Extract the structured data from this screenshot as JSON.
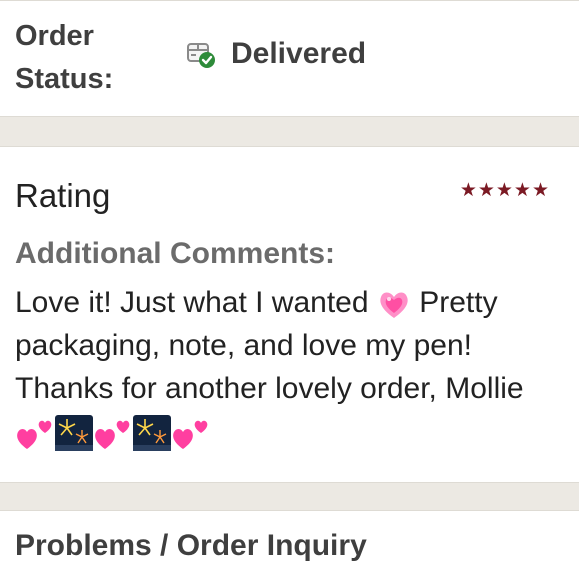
{
  "order_status": {
    "label": "Order Status:",
    "value": "Delivered",
    "icon": "package-delivered-icon",
    "check_color": "#2e8b3a"
  },
  "rating": {
    "title": "Rating",
    "stars": "★★★★★",
    "score": 5,
    "max": 5,
    "star_color": "#7b1a24"
  },
  "comments": {
    "label": "Additional Comments:",
    "text_part1": "Love it! Just what I wanted",
    "text_part2": " Pretty packaging, note, and love my pen! Thanks for another lovely order, Mollie ",
    "emoji_icons": [
      "sparkling-heart-icon",
      "two-hearts-icon",
      "fireworks-icon",
      "two-hearts-icon",
      "fireworks-icon",
      "two-hearts-icon"
    ]
  },
  "problems": {
    "title": "Problems / Order Inquiry"
  }
}
